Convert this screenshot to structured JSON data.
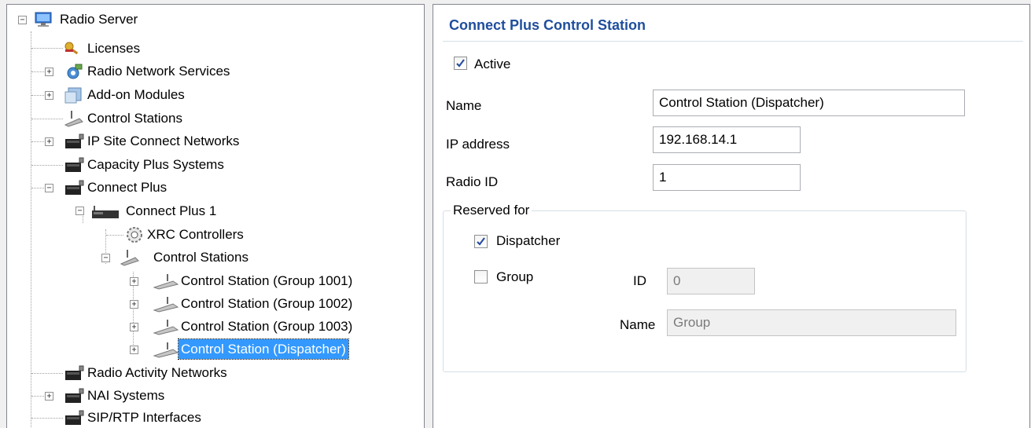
{
  "tree": {
    "nodes": [
      {
        "label": "Radio Server",
        "icon": "monitor-icon"
      },
      {
        "label": "Licenses",
        "icon": "key-icon"
      },
      {
        "label": "Radio Network Services",
        "icon": "gear-network-icon"
      },
      {
        "label": "Add-on Modules",
        "icon": "modules-icon"
      },
      {
        "label": "Control Stations",
        "icon": "radio-icon"
      },
      {
        "label": "IP Site Connect Networks",
        "icon": "repeater-icon"
      },
      {
        "label": "Capacity Plus Systems",
        "icon": "repeater-icon"
      },
      {
        "label": "Connect Plus",
        "icon": "repeater-icon"
      },
      {
        "label": "Connect Plus 1",
        "icon": "device-icon"
      },
      {
        "label": "XRC Controllers",
        "icon": "controller-icon"
      },
      {
        "label": "Control Stations",
        "icon": "radio-icon"
      },
      {
        "label": "Control Station (Group 1001)",
        "icon": "radio-icon"
      },
      {
        "label": "Control Station (Group 1002)",
        "icon": "radio-icon"
      },
      {
        "label": "Control Station (Group 1003)",
        "icon": "radio-icon"
      },
      {
        "label": "Control Station (Dispatcher)",
        "icon": "radio-icon",
        "selected": true
      },
      {
        "label": "Radio Activity Networks",
        "icon": "repeater-icon"
      },
      {
        "label": "NAI Systems",
        "icon": "repeater-icon"
      },
      {
        "label": "SIP/RTP Interfaces",
        "icon": "repeater-icon"
      }
    ]
  },
  "panel": {
    "title": "Connect Plus Control Station",
    "active_label": "Active",
    "active_checked": true,
    "name_label": "Name",
    "name_value": "Control Station (Dispatcher)",
    "ip_label": "IP address",
    "ip_value": "192.168.14.1",
    "radio_id_label": "Radio ID",
    "radio_id_value": "1",
    "reserved": {
      "legend": "Reserved for",
      "dispatcher_label": "Dispatcher",
      "dispatcher_checked": true,
      "group_label": "Group",
      "group_checked": false,
      "id_label": "ID",
      "id_value": "0",
      "group_name_label": "Name",
      "group_name_value": "Group"
    }
  },
  "colors": {
    "selection": "#3399ff",
    "title": "#1f4e9c",
    "check": "#2a4ea0"
  }
}
